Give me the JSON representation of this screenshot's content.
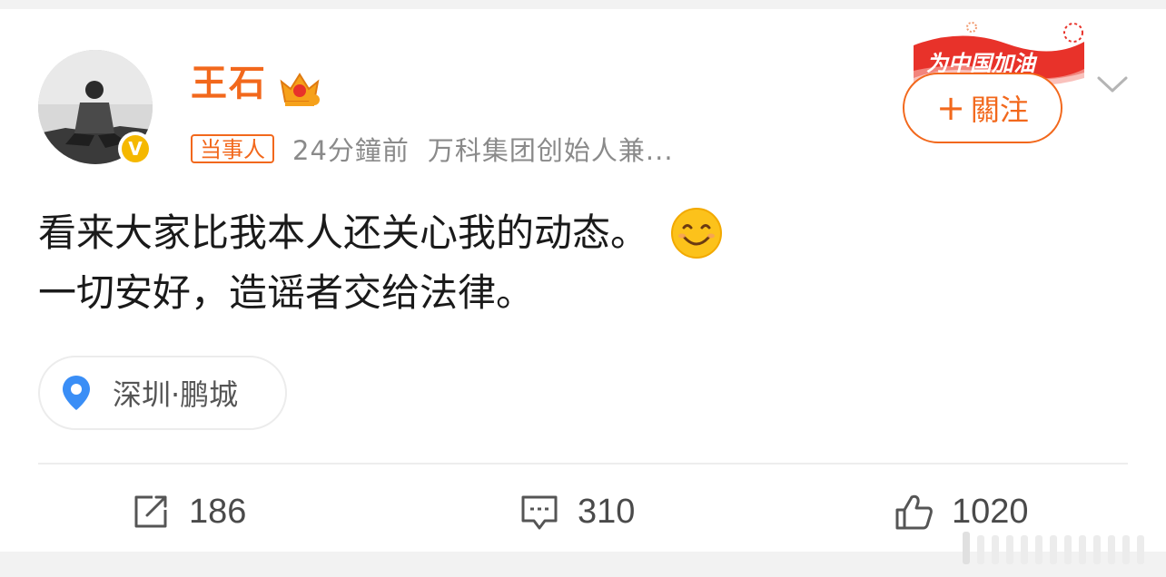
{
  "post": {
    "author_name": "王石",
    "author_tag": "当事人",
    "time_ago": "24分鐘前",
    "author_desc": "万科集团创始人兼...",
    "text_line1": "看来大家比我本人还关心我的动态。",
    "text_line2": "一切安好，造谣者交给法律。",
    "emoji": "smile-emoji",
    "location": "深圳·鹏城",
    "verified_badge": "V"
  },
  "campaign": {
    "label": "为中国加油"
  },
  "follow": {
    "plus": "+",
    "label": "關注"
  },
  "actions": {
    "repost_count": "186",
    "comment_count": "310",
    "like_count": "1020"
  },
  "colors": {
    "accent": "#f2681c",
    "badge": "#f5b800",
    "location_pin": "#3a8ef6",
    "campaign_red": "#e8322a"
  },
  "icons": [
    "crown-icon",
    "chevron-down-icon",
    "location-pin-icon",
    "repost-icon",
    "comment-icon",
    "like-icon"
  ]
}
